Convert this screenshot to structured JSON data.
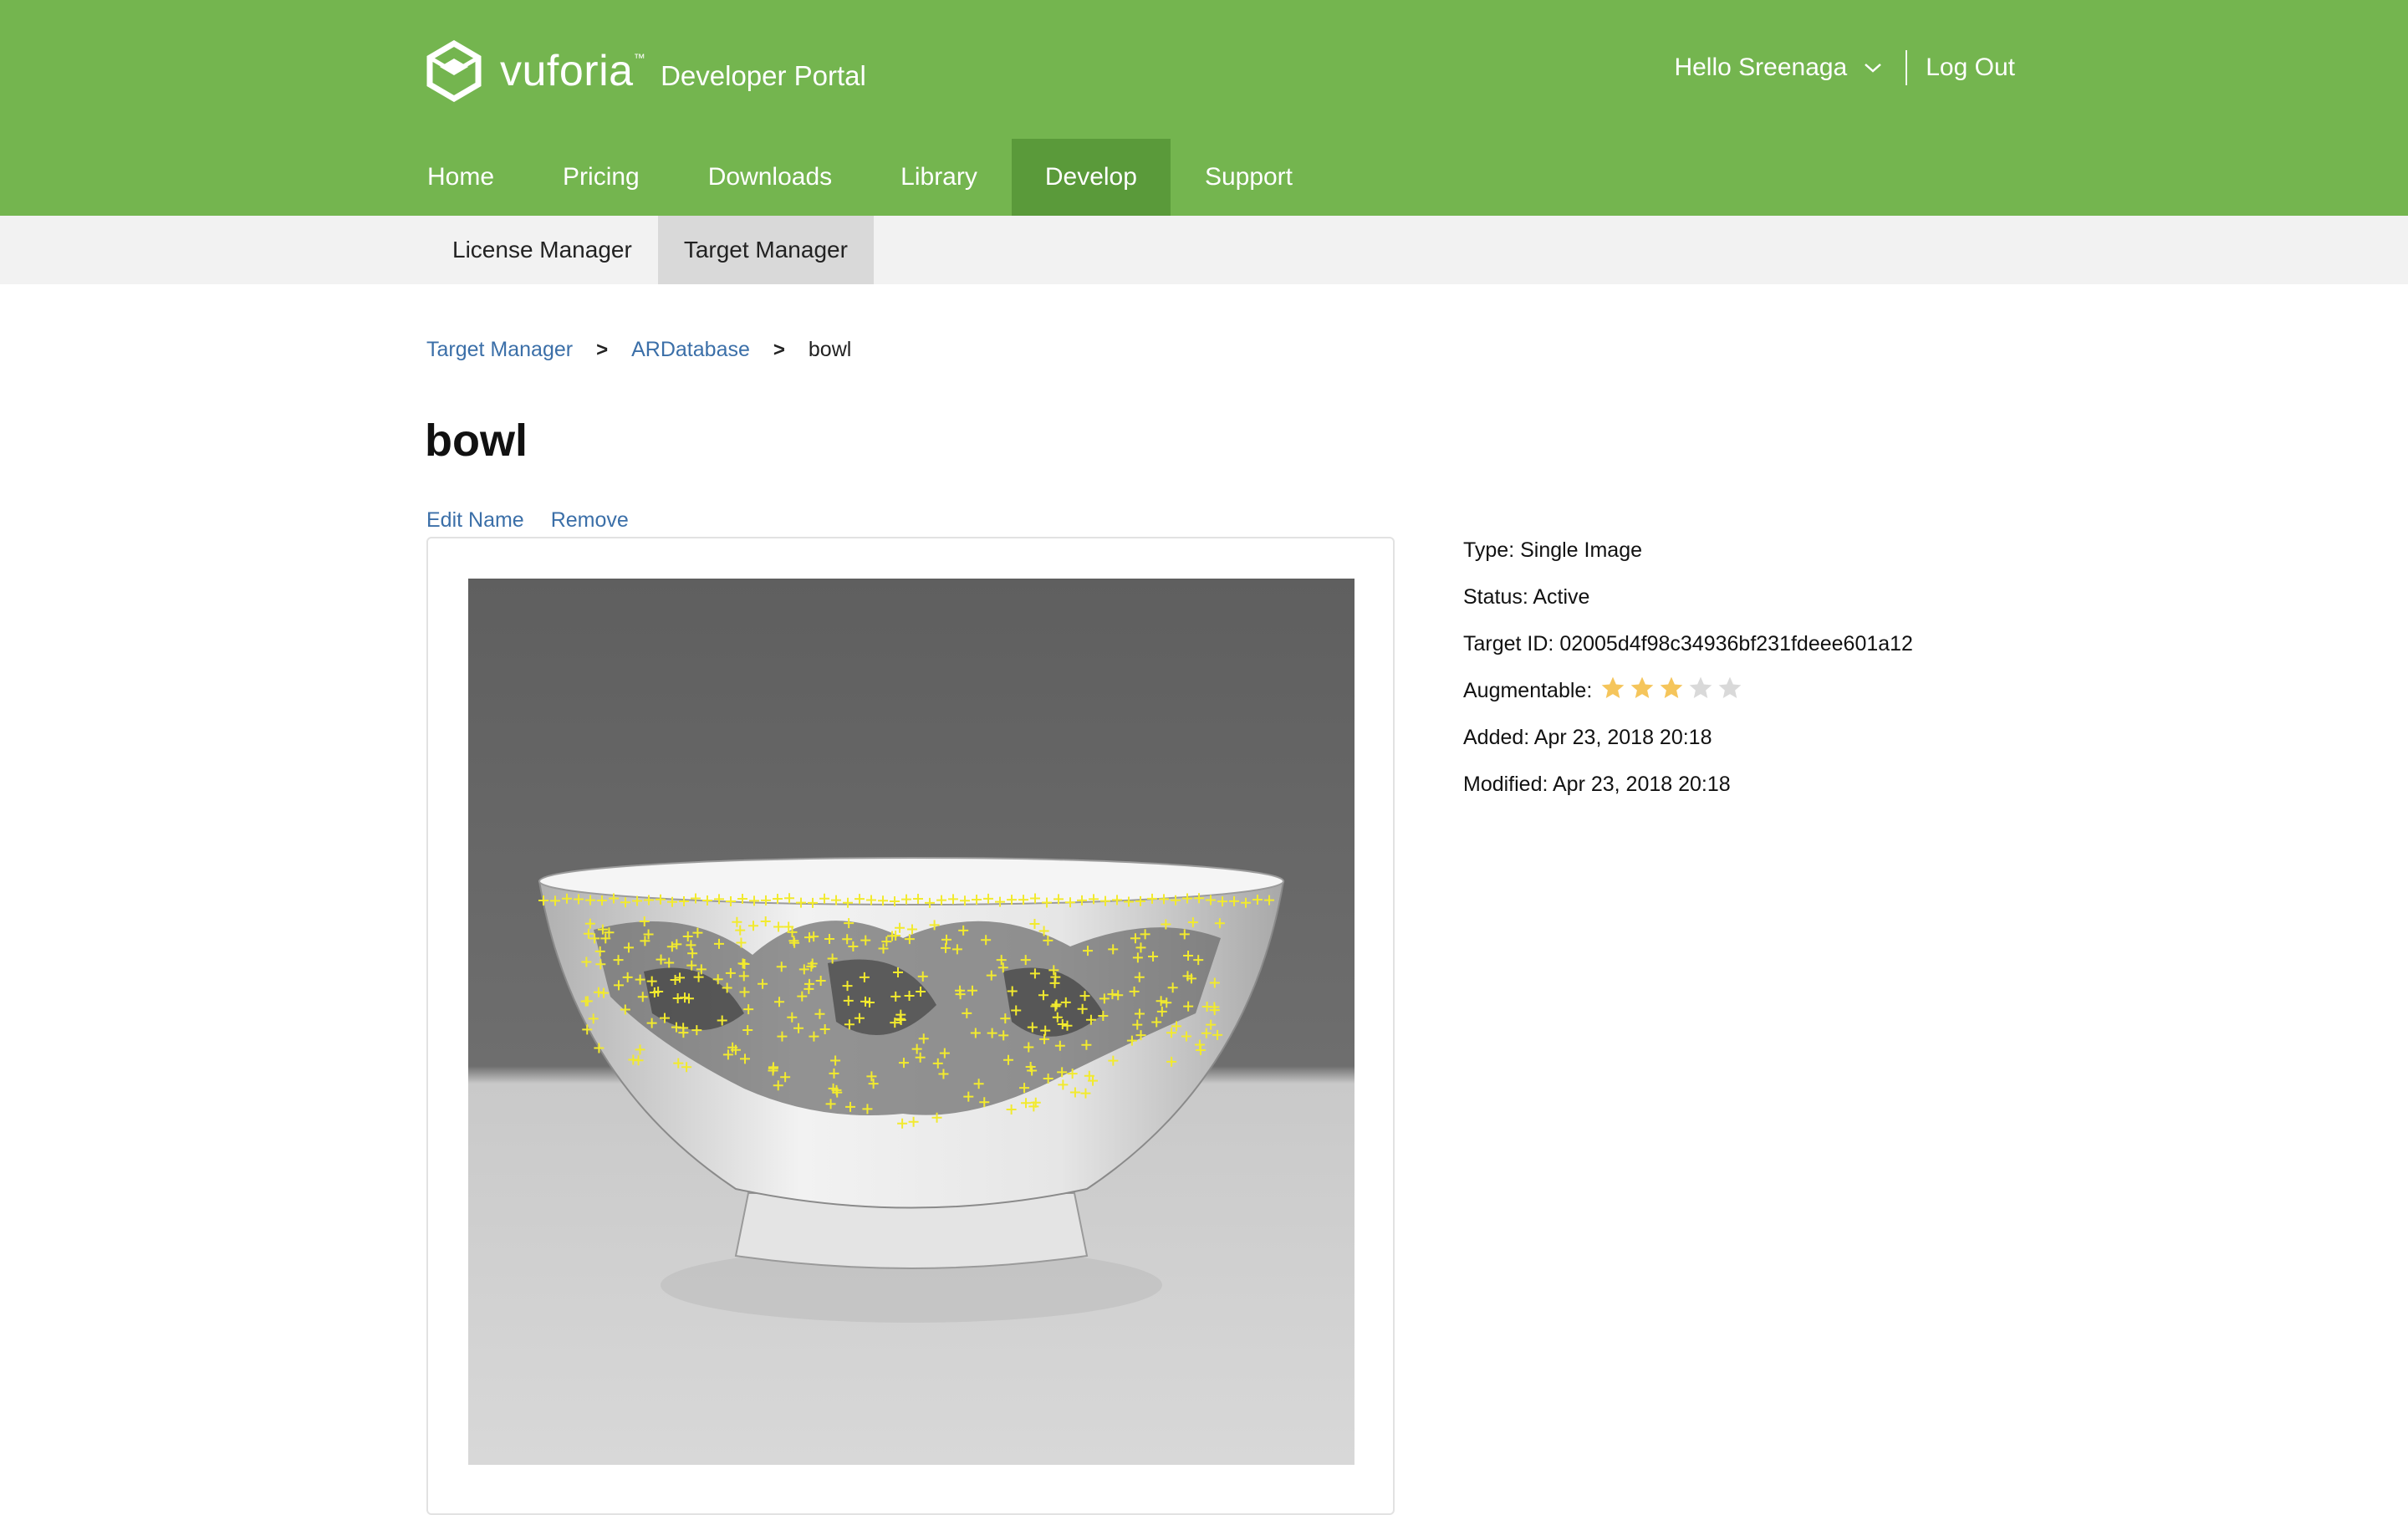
{
  "header": {
    "brand": "vuforia",
    "brand_tm": "™",
    "brand_sub": "Developer Portal",
    "greeting": "Hello Sreenaga",
    "logout": "Log Out",
    "colors": {
      "topbar": "#74b54f",
      "nav_active": "#5a9a3a"
    }
  },
  "nav": {
    "items": [
      {
        "label": "Home",
        "active": false
      },
      {
        "label": "Pricing",
        "active": false
      },
      {
        "label": "Downloads",
        "active": false
      },
      {
        "label": "Library",
        "active": false
      },
      {
        "label": "Develop",
        "active": true
      },
      {
        "label": "Support",
        "active": false
      }
    ]
  },
  "subnav": {
    "items": [
      {
        "label": "License Manager",
        "active": false
      },
      {
        "label": "Target Manager",
        "active": true
      }
    ]
  },
  "breadcrumb": {
    "items": [
      "Target Manager",
      "ARDatabase",
      "bowl"
    ],
    "separator": ">"
  },
  "target": {
    "title": "bowl",
    "actions": {
      "edit": "Edit Name",
      "remove": "Remove"
    },
    "details": {
      "type": "Type: Single Image",
      "status": "Status: Active",
      "target_id": "Target ID: 02005d4f98c34936bf231fdeee601a12",
      "augmentable_label": "Augmentable:",
      "augmentable_rating": 3,
      "augmentable_max": 5,
      "added": "Added: Apr 23, 2018 20:18",
      "modified": "Modified: Apr 23, 2018 20:18"
    },
    "image": {
      "subject": "grayscale photo of a floral porcelain bowl with yellow feature-point markers",
      "feature_color": "#f2ea2e"
    }
  },
  "icons": {
    "logo": "vuforia-cube-icon",
    "chevron": "chevron-down-icon",
    "star_filled": "star-filled-icon",
    "star_empty": "star-empty-icon"
  },
  "colors": {
    "link": "#3b6fa8",
    "star_filled": "#f5c55b",
    "star_empty": "#d9d9d9",
    "subnav_bg": "#f2f2f2",
    "subnav_active": "#d9d9d9"
  }
}
